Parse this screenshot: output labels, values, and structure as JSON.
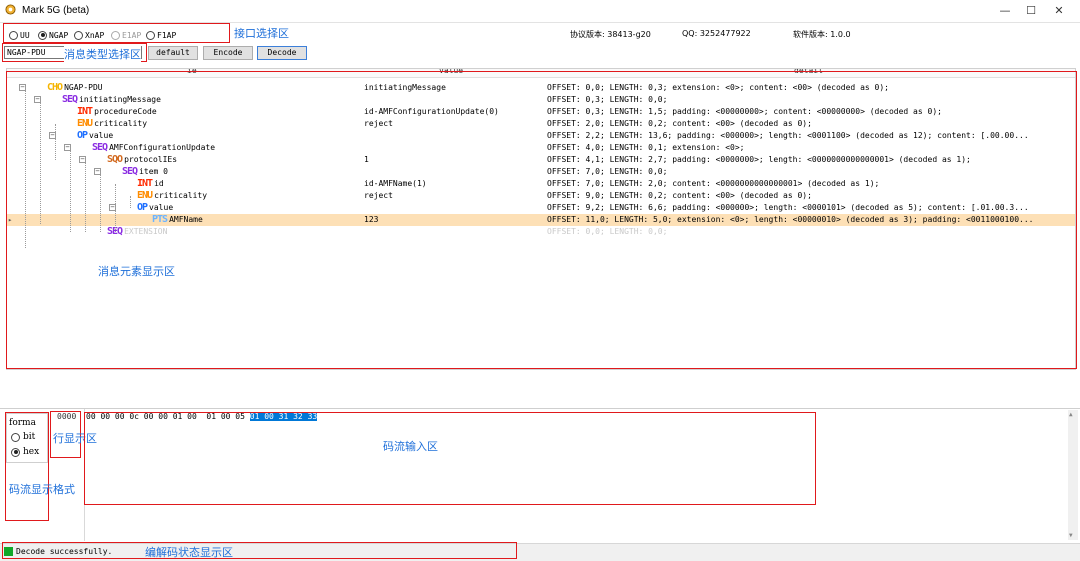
{
  "window": {
    "title": "Mark 5G (beta)",
    "minimize": "—",
    "maximize": "☐",
    "close": "✕"
  },
  "interfaces": [
    {
      "label": "UU",
      "checked": false,
      "disabled": false
    },
    {
      "label": "NGAP",
      "checked": true,
      "disabled": false
    },
    {
      "label": "XnAP",
      "checked": false,
      "disabled": false
    },
    {
      "label": "E1AP",
      "checked": false,
      "disabled": true
    },
    {
      "label": "F1AP",
      "checked": false,
      "disabled": false
    }
  ],
  "info": {
    "protocol_version": "协议版本: 38413-g20",
    "qq": "QQ: 3252477922",
    "software_version": "软件版本: 1.0.0"
  },
  "toolbar": {
    "message_type": "NGAP-PDU",
    "default_label": "default",
    "encode_label": "Encode",
    "decode_label": "Decode"
  },
  "grid": {
    "columns": [
      "ie",
      "value",
      "detail"
    ],
    "rows": [
      {
        "tag": "CHO",
        "tag_color": "#f5b400",
        "name": "NGAP-PDU",
        "value": "initiatingMessage",
        "detail": "OFFSET: 0,0; LENGTH: 0,3; extension: <0>; content: <00> (decoded as 0);"
      },
      {
        "tag": "SEQ",
        "tag_color": "#8a2be2",
        "name": "initiatingMessage",
        "value": "",
        "detail": "OFFSET: 0,3; LENGTH: 0,0;"
      },
      {
        "tag": "INT",
        "tag_color": "#ff2a00",
        "name": "procedureCode",
        "value": "id-AMFConfigurationUpdate(0)",
        "detail": "OFFSET: 0,3; LENGTH: 1,5; padding: <00000000>; content: <00000000> (decoded as 0);"
      },
      {
        "tag": "ENU",
        "tag_color": "#ff8c00",
        "name": "criticality",
        "value": "reject",
        "detail": "OFFSET: 2,0; LENGTH: 0,2; content: <00> (decoded as 0);"
      },
      {
        "tag": "OP",
        "tag_color": "#1e6fff",
        "name": "value",
        "value": "",
        "detail": "OFFSET: 2,2; LENGTH: 13,6; padding: <000000>; length: <0001100> (decoded as 12); content: [.00.00..."
      },
      {
        "tag": "SEQ",
        "tag_color": "#8a2be2",
        "name": "AMFConfigurationUpdate",
        "value": "",
        "detail": "OFFSET: 4,0; LENGTH: 0,1; extension: <0>;"
      },
      {
        "tag": "SQO",
        "tag_color": "#d2691e",
        "name": "protocolIEs",
        "value": "1",
        "detail": "OFFSET: 4,1; LENGTH: 2,7; padding: <0000000>; length: <0000000000000001> (decoded as 1);"
      },
      {
        "tag": "SEQ",
        "tag_color": "#8a2be2",
        "name": "item 0",
        "value": "",
        "detail": "OFFSET: 7,0; LENGTH: 0,0;"
      },
      {
        "tag": "INT",
        "tag_color": "#ff2a00",
        "name": "id",
        "value": "id-AMFName(1)",
        "detail": "OFFSET: 7,0; LENGTH: 2,0; content: <0000000000000001> (decoded as 1);"
      },
      {
        "tag": "ENU",
        "tag_color": "#ff8c00",
        "name": "criticality",
        "value": "reject",
        "detail": "OFFSET: 9,0; LENGTH: 0,2; content: <00> (decoded as 0);"
      },
      {
        "tag": "OP",
        "tag_color": "#1e6fff",
        "name": "value",
        "value": "",
        "detail": "OFFSET: 9,2; LENGTH: 6,6; padding: <000000>; length: <0000101> (decoded as 5); content: [.01.00.3..."
      },
      {
        "tag": "PTS",
        "tag_color": "#6cb4ff",
        "name": "AMFName",
        "value": "123",
        "detail": "OFFSET: 11,0; LENGTH: 5,0; extension: <0>; length: <00000010> (decoded as 3); padding: <0011000100..."
      },
      {
        "tag": "SEQ",
        "tag_color": "#8a2be2",
        "name": "EXTENSION",
        "value": "",
        "detail": "OFFSET: 0,0; LENGTH: 0,0;"
      }
    ]
  },
  "format": {
    "label": "forma",
    "options": [
      {
        "label": "bit",
        "checked": false
      },
      {
        "label": "hex",
        "checked": true
      }
    ]
  },
  "stream": {
    "line_number": "0000",
    "hex_plain": "00 00 00 0c 00 00 01 00  01 00 05 ",
    "hex_selected": "01 00 31 32 33"
  },
  "status": {
    "text": "Decode successfully.",
    "indicator_color": "#11a829"
  },
  "annotations": {
    "interface_area": "接口选择区",
    "message_type_area": "消息类型选择区",
    "element_area": "消息元素显示区",
    "line_area": "行显示区",
    "stream_input_area": "码流输入区",
    "stream_format_area": "码流显示格式",
    "status_area": "编解码状态显示区"
  }
}
